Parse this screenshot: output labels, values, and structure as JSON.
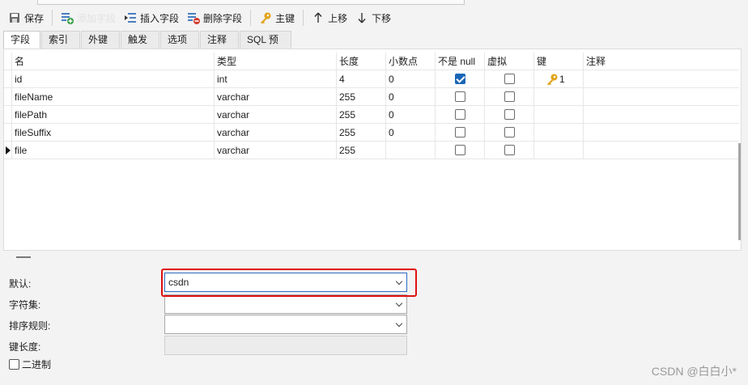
{
  "toolbar": {
    "save": "保存",
    "add_field": "添加字段",
    "insert_field": "插入字段",
    "delete_field": "删除字段",
    "primary_key": "主键",
    "move_up": "上移",
    "move_down": "下移"
  },
  "tabs": [
    "字段",
    "索引",
    "外键",
    "触发器",
    "选项",
    "注释",
    "SQL 预览"
  ],
  "grid": {
    "headers": {
      "name": "名",
      "type": "类型",
      "length": "长度",
      "decimals": "小数点",
      "not_null": "不是 null",
      "virtual": "虚拟",
      "key": "键",
      "comment": "注释"
    },
    "rows": [
      {
        "name": "id",
        "type": "int",
        "length": "4",
        "decimals": "0",
        "not_null": true,
        "virtual": false,
        "key": "1",
        "comment": ""
      },
      {
        "name": "fileName",
        "type": "varchar",
        "length": "255",
        "decimals": "0",
        "not_null": false,
        "virtual": false,
        "key": "",
        "comment": ""
      },
      {
        "name": "filePath",
        "type": "varchar",
        "length": "255",
        "decimals": "0",
        "not_null": false,
        "virtual": false,
        "key": "",
        "comment": ""
      },
      {
        "name": "fileSuffix",
        "type": "varchar",
        "length": "255",
        "decimals": "0",
        "not_null": false,
        "virtual": false,
        "key": "",
        "comment": ""
      },
      {
        "name": "file",
        "type": "varchar",
        "length": "255",
        "decimals": "",
        "not_null": false,
        "virtual": false,
        "key": "",
        "comment": ""
      }
    ]
  },
  "props": {
    "default_label": "默认:",
    "default_value": "csdn",
    "charset_label": "字符集:",
    "charset_value": "",
    "collation_label": "排序规则:",
    "collation_value": "",
    "key_length_label": "键长度:",
    "binary_label": "二进制"
  },
  "watermark": "CSDN @白白小*",
  "colors": {
    "accent": "#1a66b6",
    "highlight": "#e01010",
    "key_icon": "#e0a31a"
  }
}
